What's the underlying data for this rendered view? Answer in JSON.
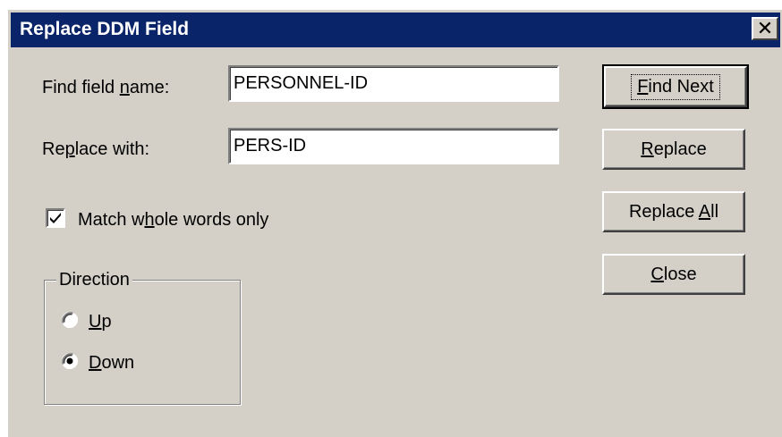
{
  "dialog": {
    "title": "Replace DDM Field",
    "close_glyph": "✕"
  },
  "find": {
    "label_pre": "Find field ",
    "label_accel": "n",
    "label_post": "ame:",
    "value": "PERSONNEL-ID"
  },
  "replace": {
    "label_pre": "Re",
    "label_accel": "p",
    "label_post": "lace with:",
    "value": "PERS-ID"
  },
  "options": {
    "match_whole_pre": "Match w",
    "match_whole_accel": "h",
    "match_whole_post": "ole words only",
    "match_whole_checked": true
  },
  "direction": {
    "legend": "Direction",
    "up_accel": "U",
    "up_rest": "p",
    "down_accel": "D",
    "down_rest": "own",
    "selected": "Down"
  },
  "buttons": {
    "find_next_accel": "F",
    "find_next_rest": "ind Next",
    "replace_accel": "R",
    "replace_rest": "eplace",
    "replace_all_pre": "Replace ",
    "replace_all_accel": "A",
    "replace_all_post": "ll",
    "close_accel": "C",
    "close_rest": "lose"
  },
  "colors": {
    "titlebar": "#0a246a",
    "face": "#d4d0c8"
  }
}
